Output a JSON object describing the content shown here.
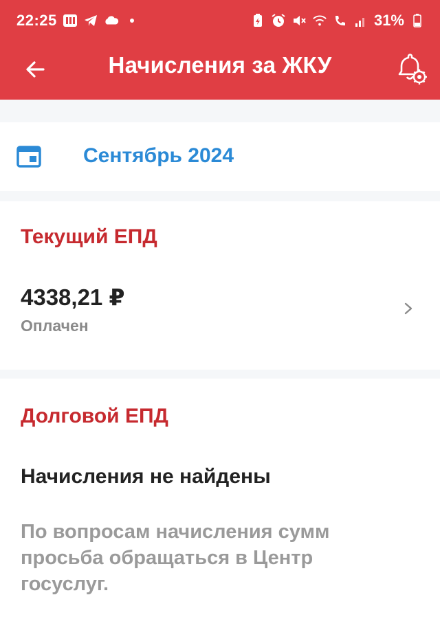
{
  "status_bar": {
    "time": "22:25",
    "battery": "31%",
    "icons": [
      "news-icon",
      "telegram-icon",
      "cloud-icon",
      "dot-icon",
      "battery-saver-icon",
      "alarm-icon",
      "mute-icon",
      "wifi-icon",
      "wifi-call-icon",
      "signal-icon",
      "battery-icon"
    ]
  },
  "header": {
    "title": "Начисления за ЖКУ",
    "back_icon": "arrow-left-icon",
    "notify_icon": "bell-settings-icon",
    "color": "#e03e44"
  },
  "period": {
    "icon": "calendar-icon",
    "month": "Сентябрь 2024",
    "color": "#2b8ad6"
  },
  "current_epd": {
    "title": "Текущий ЕПД",
    "amount": "4338,21 ₽",
    "status": "Оплачен",
    "accent": "#c62a2f"
  },
  "debt_epd": {
    "title": "Долговой ЕПД",
    "empty_message": "Начисления не найдены",
    "hint": "По вопросам начисления сумм просьба обращаться в Центр госуслуг."
  }
}
